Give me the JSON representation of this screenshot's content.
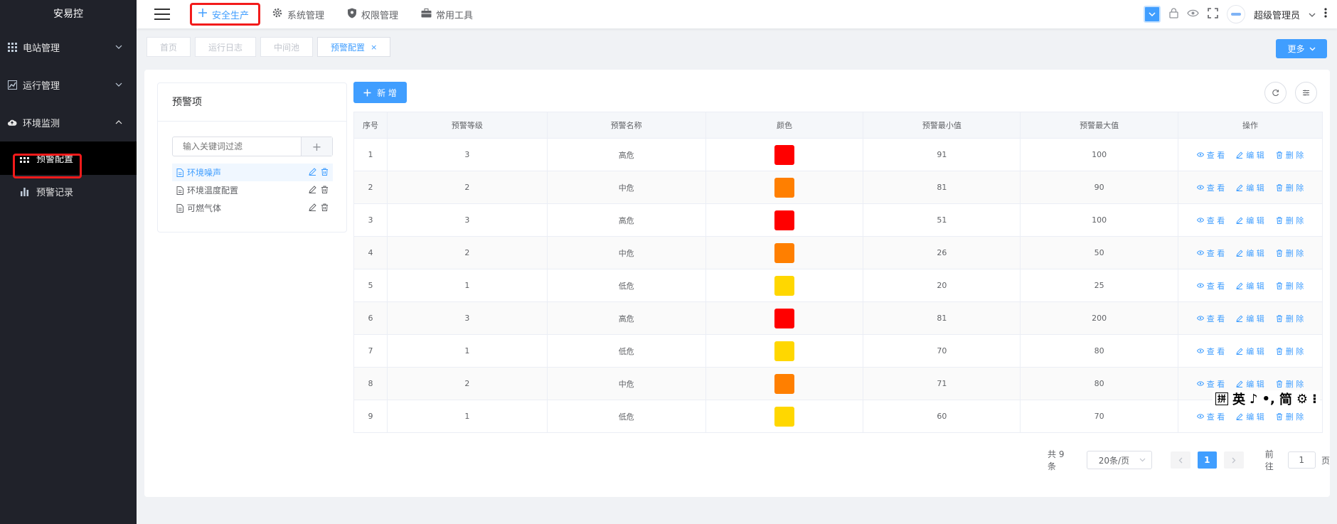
{
  "app": {
    "title": "安易控"
  },
  "sidebar": {
    "menus": [
      {
        "label": "电站管理",
        "icon": "grid-icon",
        "expanded": false
      },
      {
        "label": "运行管理",
        "icon": "chart-line-icon",
        "expanded": false
      },
      {
        "label": "环境监测",
        "icon": "cloud-icon",
        "expanded": true
      }
    ],
    "sub_items": [
      {
        "label": "预警配置",
        "icon": "grid-icon",
        "active": true
      },
      {
        "label": "预警记录",
        "icon": "bar-chart-icon",
        "active": false
      }
    ]
  },
  "topbar": {
    "nav": [
      {
        "label": "安全生产",
        "icon": "plus-icon",
        "active": true
      },
      {
        "label": "系统管理",
        "icon": "gear-icon",
        "active": false
      },
      {
        "label": "权限管理",
        "icon": "shield-icon",
        "active": false
      },
      {
        "label": "常用工具",
        "icon": "briefcase-icon",
        "active": false
      }
    ],
    "user": {
      "name": "超级管理员"
    }
  },
  "tags": {
    "items": [
      "首页",
      "运行日志",
      "中间池",
      "预警配置"
    ],
    "more_label": "更多"
  },
  "panel": {
    "title": "预警项",
    "search_placeholder": "输入关键词过滤",
    "tree": [
      {
        "label": "环境噪声",
        "selected": true
      },
      {
        "label": "环境温度配置",
        "selected": false
      },
      {
        "label": "可燃气体",
        "selected": false
      }
    ]
  },
  "toolbar": {
    "add_label": "新 增"
  },
  "table": {
    "headers": [
      "序号",
      "预警等级",
      "预警名称",
      "颜色",
      "预警最小值",
      "预警最大值",
      "操作"
    ],
    "rows": [
      {
        "no": "1",
        "level": "3",
        "name": "高危",
        "color": "#ff0000",
        "min": "91",
        "max": "100"
      },
      {
        "no": "2",
        "level": "2",
        "name": "中危",
        "color": "#ff7f00",
        "min": "81",
        "max": "90"
      },
      {
        "no": "3",
        "level": "3",
        "name": "高危",
        "color": "#ff0000",
        "min": "51",
        "max": "100"
      },
      {
        "no": "4",
        "level": "2",
        "name": "中危",
        "color": "#ff7f00",
        "min": "26",
        "max": "50"
      },
      {
        "no": "5",
        "level": "1",
        "name": "低危",
        "color": "#ffd700",
        "min": "20",
        "max": "25"
      },
      {
        "no": "6",
        "level": "3",
        "name": "高危",
        "color": "#ff0000",
        "min": "81",
        "max": "200"
      },
      {
        "no": "7",
        "level": "1",
        "name": "低危",
        "color": "#ffd700",
        "min": "70",
        "max": "80"
      },
      {
        "no": "8",
        "level": "2",
        "name": "中危",
        "color": "#ff7f00",
        "min": "71",
        "max": "80"
      },
      {
        "no": "9",
        "level": "1",
        "name": "低危",
        "color": "#ffd700",
        "min": "60",
        "max": "70"
      }
    ],
    "ops": {
      "view": "查 看",
      "edit": "编 辑",
      "delete": "删 除"
    }
  },
  "pagination": {
    "total_text": "共 9 条",
    "page_size": "20条/页",
    "current_page": "1",
    "goto_prefix": "前往",
    "goto_value": "1",
    "goto_suffix": "页"
  },
  "ime": {
    "labels": [
      "拼",
      "英",
      "♪",
      "•,",
      "简",
      "⚙",
      "⁝"
    ]
  },
  "colors": {
    "primary": "#409eff",
    "high": "#ff0000",
    "medium": "#ff7f00",
    "low": "#ffd700",
    "sidebar_bg": "#20222a"
  }
}
